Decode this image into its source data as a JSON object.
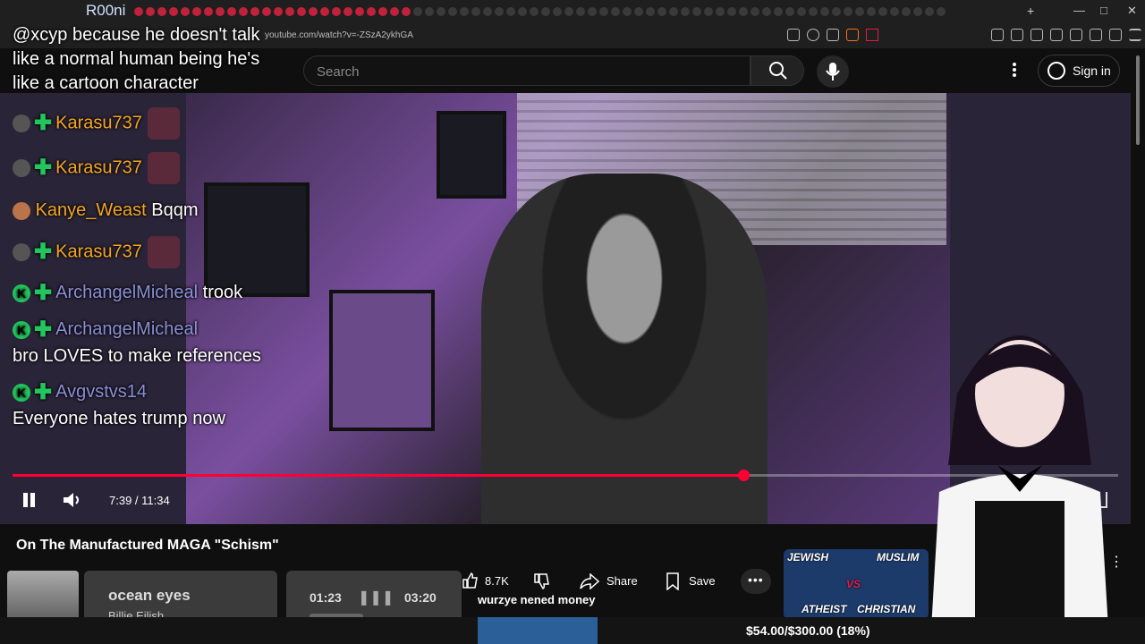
{
  "browser": {
    "window_title": "R00ni",
    "url": "youtube.com/watch?v=-ZSzA2ykhGA",
    "new_tab": "+"
  },
  "header": {
    "search_placeholder": "Search",
    "signin_label": "Sign in"
  },
  "chat": {
    "top_message": "@xcyp because he doesn't talk like a normal human being he's like a cartoon character",
    "lines": [
      {
        "name": "Karasu737",
        "name_color": "#f5a623",
        "text": ""
      },
      {
        "name": "Karasu737",
        "name_color": "#f5a623",
        "text": ""
      },
      {
        "name": "Kanye_Weast",
        "name_color": "#f5a623",
        "text": "Bqqm"
      },
      {
        "name": "Karasu737",
        "name_color": "#f5a623",
        "text": ""
      },
      {
        "name": "ArchangelMicheal",
        "name_color": "#8a8fd6",
        "text": "trook"
      },
      {
        "name": "ArchangelMicheal",
        "name_color": "#8a8fd6",
        "text": "bro LOVES to make references"
      },
      {
        "name": "Avgvstvs14",
        "name_color": "#8a8fd6",
        "text": "Everyone hates trump now"
      }
    ]
  },
  "player": {
    "current_time": "7:39",
    "duration": "11:34",
    "timecode": "7:39 / 11:34",
    "progress_fraction": 0.661,
    "accent": "#ff0033"
  },
  "video": {
    "title": "On The Manufactured MAGA \"Schism\""
  },
  "actions": {
    "likes": "8.7K",
    "share_label": "Share",
    "save_label": "Save"
  },
  "now_playing": {
    "title": "ocean eyes",
    "artist": "Billie Eilish",
    "elapsed": "01:23",
    "total": "03:20"
  },
  "donation_message": "wurzye nened money",
  "thumbnail": {
    "labels": [
      "JEWISH",
      "MUSLIM",
      "ATHEIST",
      "CHRISTIAN"
    ],
    "vs": "VS"
  },
  "goal": {
    "text": "$54.00/$300.00 (18%)",
    "fraction": 0.18
  }
}
